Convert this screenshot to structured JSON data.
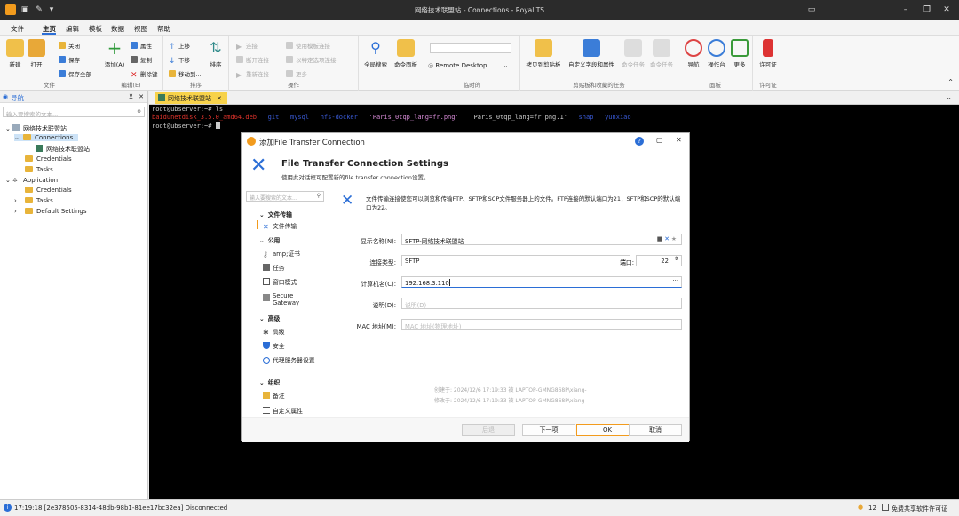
{
  "window": {
    "title": "网络技术联盟站 - Connections - Royal TS"
  },
  "menu": {
    "file": "文件",
    "home": "主页",
    "edit": "编辑",
    "template": "模板",
    "data": "数据",
    "view": "视图",
    "help": "帮助"
  },
  "ribbon": {
    "file": {
      "new": "新建",
      "open": "打开",
      "close": "关闭",
      "save": "保存",
      "save_all": "保存全部",
      "label": "文件"
    },
    "edit": {
      "add": "添加(A)",
      "props": "属性",
      "copy": "复制",
      "delete": "删除键",
      "label": "编辑(E)"
    },
    "sort": {
      "up": "上移",
      "down": "下移",
      "move": "移动到...",
      "sort": "排序",
      "label": "排序"
    },
    "actions": {
      "connect": "连接",
      "disconnect": "断开连接",
      "reconnect": "重新连接",
      "use_template": "使用模板连接",
      "connect_options": "以特定选项连接",
      "more": "更多",
      "label": "操作"
    },
    "search": {
      "global": "全局搜索",
      "cmd": "命令面板"
    },
    "adhoc": {
      "rdp": "Remote Desktop",
      "label": "临时的"
    },
    "clip": {
      "copy_clip": "拷贝到剪贴板",
      "custom": "自定义字段和属性",
      "task": "命令任务",
      "cmd_task": "命令任务",
      "label": "剪贴板和收藏的任务"
    },
    "panel": {
      "nav": "导航",
      "dashboard": "操作台",
      "more": "更多",
      "label": "面板"
    },
    "license": {
      "license": "许可证",
      "label": "许可证"
    }
  },
  "sidebar": {
    "title": "导航",
    "search_ph": "输入要搜索的文本...",
    "items": [
      "网络技术联盟站",
      "Connections",
      "网络技术联盟站",
      "Credentials",
      "Tasks",
      "Application",
      "Credentials",
      "Tasks",
      "Default Settings"
    ]
  },
  "tab": {
    "label": "网络技术联盟站"
  },
  "terminal": {
    "l1": "root@ubserver:~# ls",
    "files": [
      "baidunetdisk_3.5.0_amd64.deb",
      "git",
      "mysql",
      "nfs-docker",
      "'Paris_0tqp_lang=fr.png'",
      "'Paris_0tqp_lang=fr.png.1'",
      "snap",
      "yunxiao"
    ],
    "l3": "root@ubserver:~# "
  },
  "dialog": {
    "title": "添加File Transfer Connection",
    "heading": "File Transfer Connection Settings",
    "sub": "使用此对话框可配置新的file transfer connection设置。",
    "search_ph": "输入要搜索的文本...",
    "nav": [
      "文件传输",
      "文件传输",
      "公用",
      "amp;证书",
      "任务",
      "窗口模式",
      "Secure Gateway",
      "高级",
      "高级",
      "安全",
      "代理服务器设置",
      "组织",
      "备注",
      "自定义属性"
    ],
    "desc": "文件传输连接使您可以浏览和传输FTP、SFTP和SCP文件服务器上的文件。FTP连接的默认端口为21，SFTP和SCP的默认端口为22。",
    "labels": {
      "display": "显示名称(N):",
      "type": "连接类型:",
      "port": "端口:",
      "host": "计算机名(C):",
      "desc": "说明(D):",
      "mac": "MAC 地址(M):"
    },
    "values": {
      "display": "SFTP-网络技术联盟站",
      "type": "SFTP",
      "port": "22",
      "host": "192.168.3.110"
    },
    "placeholders": {
      "desc": "说明(D)",
      "mac": "MAC 地址(物理地址)"
    },
    "created": "创建于: 2024/12/6 17:19:33 被 LAPTOP-GMNG868P\\xiang-",
    "modified": "修改于: 2024/12/6 17:19:33 被 LAPTOP-GMNG868P\\xiang-",
    "buttons": {
      "back": "后退",
      "next": "下一项",
      "ok": "OK",
      "cancel": "取消"
    }
  },
  "status": {
    "text": "17:19:18 [2e378505-8314-48db-98b1-81ee17bc32ea] Disconnected",
    "count": "12",
    "license": "免费共享软件许可证"
  },
  "colors": {
    "accent": "#2b6ed6",
    "orange": "#f29b1d",
    "tab": "#f7d24a",
    "file_red": "#e0332b",
    "file_blue": "#3a5bd8"
  }
}
